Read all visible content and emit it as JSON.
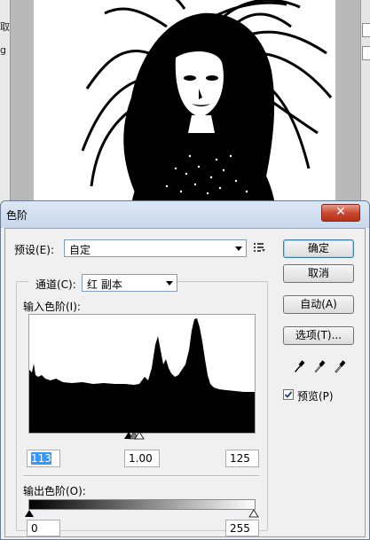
{
  "background": {
    "left_strip": [
      "取",
      "g"
    ]
  },
  "dialog": {
    "title": "色阶",
    "close_glyph": "✕",
    "preset": {
      "label": "预设(E):",
      "value": "自定"
    },
    "channel": {
      "label": "通道(C):",
      "value": "红 副本"
    },
    "input_levels": {
      "label": "输入色阶(I):",
      "black": "113",
      "gamma": "1.00",
      "white": "125"
    },
    "output_levels": {
      "label": "输出色阶(O):",
      "black": "0",
      "white": "255"
    },
    "buttons": {
      "ok": "确定",
      "cancel": "取消",
      "auto": "自动(A)",
      "options": "选项(T)..."
    },
    "preview": {
      "label": "预览(P)",
      "checked": true
    },
    "icons": [
      "preset-menu-icon",
      "black-eyedropper-icon",
      "gray-eyedropper-icon",
      "white-eyedropper-icon"
    ]
  }
}
